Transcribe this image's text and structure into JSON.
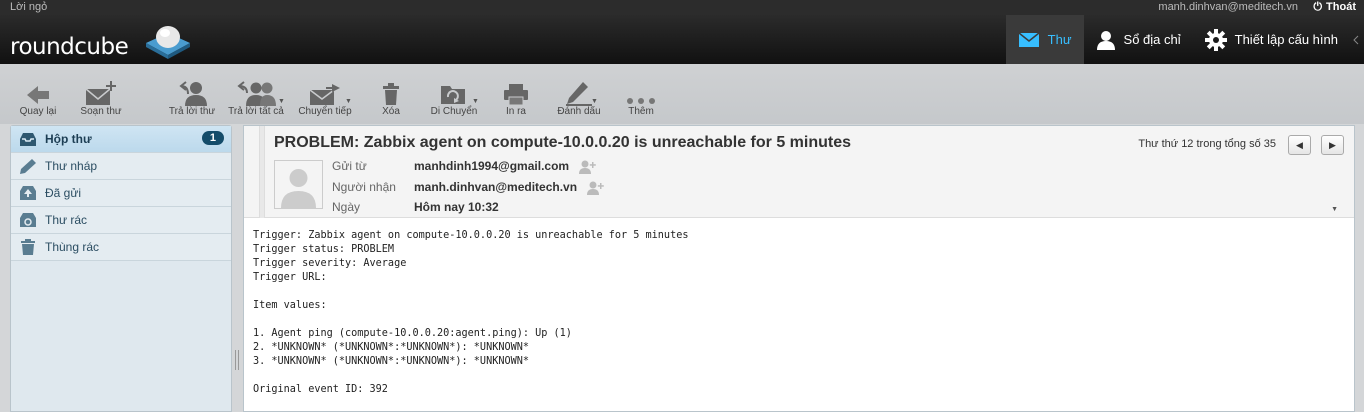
{
  "topbar": {
    "greeting": "Lời ngỏ",
    "user": "manh.dinhvan@meditech.vn",
    "logout": "Thoát"
  },
  "header": {
    "logo": "roundcube",
    "tabs": [
      {
        "label": "Thư",
        "icon": "mail-icon",
        "active": true
      },
      {
        "label": "Sổ địa chỉ",
        "icon": "person-icon",
        "active": false
      },
      {
        "label": "Thiết lập cấu hình",
        "icon": "gear-icon",
        "active": false
      }
    ]
  },
  "toolbar": {
    "back": "Quay lại",
    "compose": "Soạn thư",
    "reply": "Trả lời thư",
    "reply_all": "Trả lời tất cả",
    "forward": "Chuyển tiếp",
    "delete": "Xóa",
    "move": "Di Chuyển",
    "print": "In ra",
    "mark": "Đánh dấu",
    "more": "Thêm"
  },
  "sidebar": {
    "folders": [
      {
        "label": "Hộp thư",
        "icon": "inbox-icon",
        "badge": "1",
        "selected": true
      },
      {
        "label": "Thư nháp",
        "icon": "pencil-icon",
        "selected": false
      },
      {
        "label": "Đã gửi",
        "icon": "sent-icon",
        "selected": false
      },
      {
        "label": "Thư rác",
        "icon": "junk-icon",
        "selected": false
      },
      {
        "label": "Thùng rác",
        "icon": "trash-icon",
        "selected": false
      }
    ]
  },
  "message": {
    "subject": "PROBLEM: Zabbix agent on compute-10.0.0.20 is unreachable for 5 minutes",
    "counter": "Thư thứ 12 trong tổng số 35",
    "from_label": "Gửi từ",
    "from": "manhdinh1994@gmail.com",
    "to_label": "Người nhận",
    "to": "manh.dinhvan@meditech.vn",
    "date_label": "Ngày",
    "date": "Hôm nay 10:32",
    "body": "Trigger: Zabbix agent on compute-10.0.0.20 is unreachable for 5 minutes\nTrigger status: PROBLEM\nTrigger severity: Average\nTrigger URL:\n\nItem values:\n\n1. Agent ping (compute-10.0.0.20:agent.ping): Up (1)\n2. *UNKNOWN* (*UNKNOWN*:*UNKNOWN*): *UNKNOWN*\n3. *UNKNOWN* (*UNKNOWN*:*UNKNOWN*): *UNKNOWN*\n\nOriginal event ID: 392"
  },
  "colors": {
    "accent": "#37beff",
    "badge": "#144c6a",
    "sidebar_selected": "#c6dfef"
  }
}
